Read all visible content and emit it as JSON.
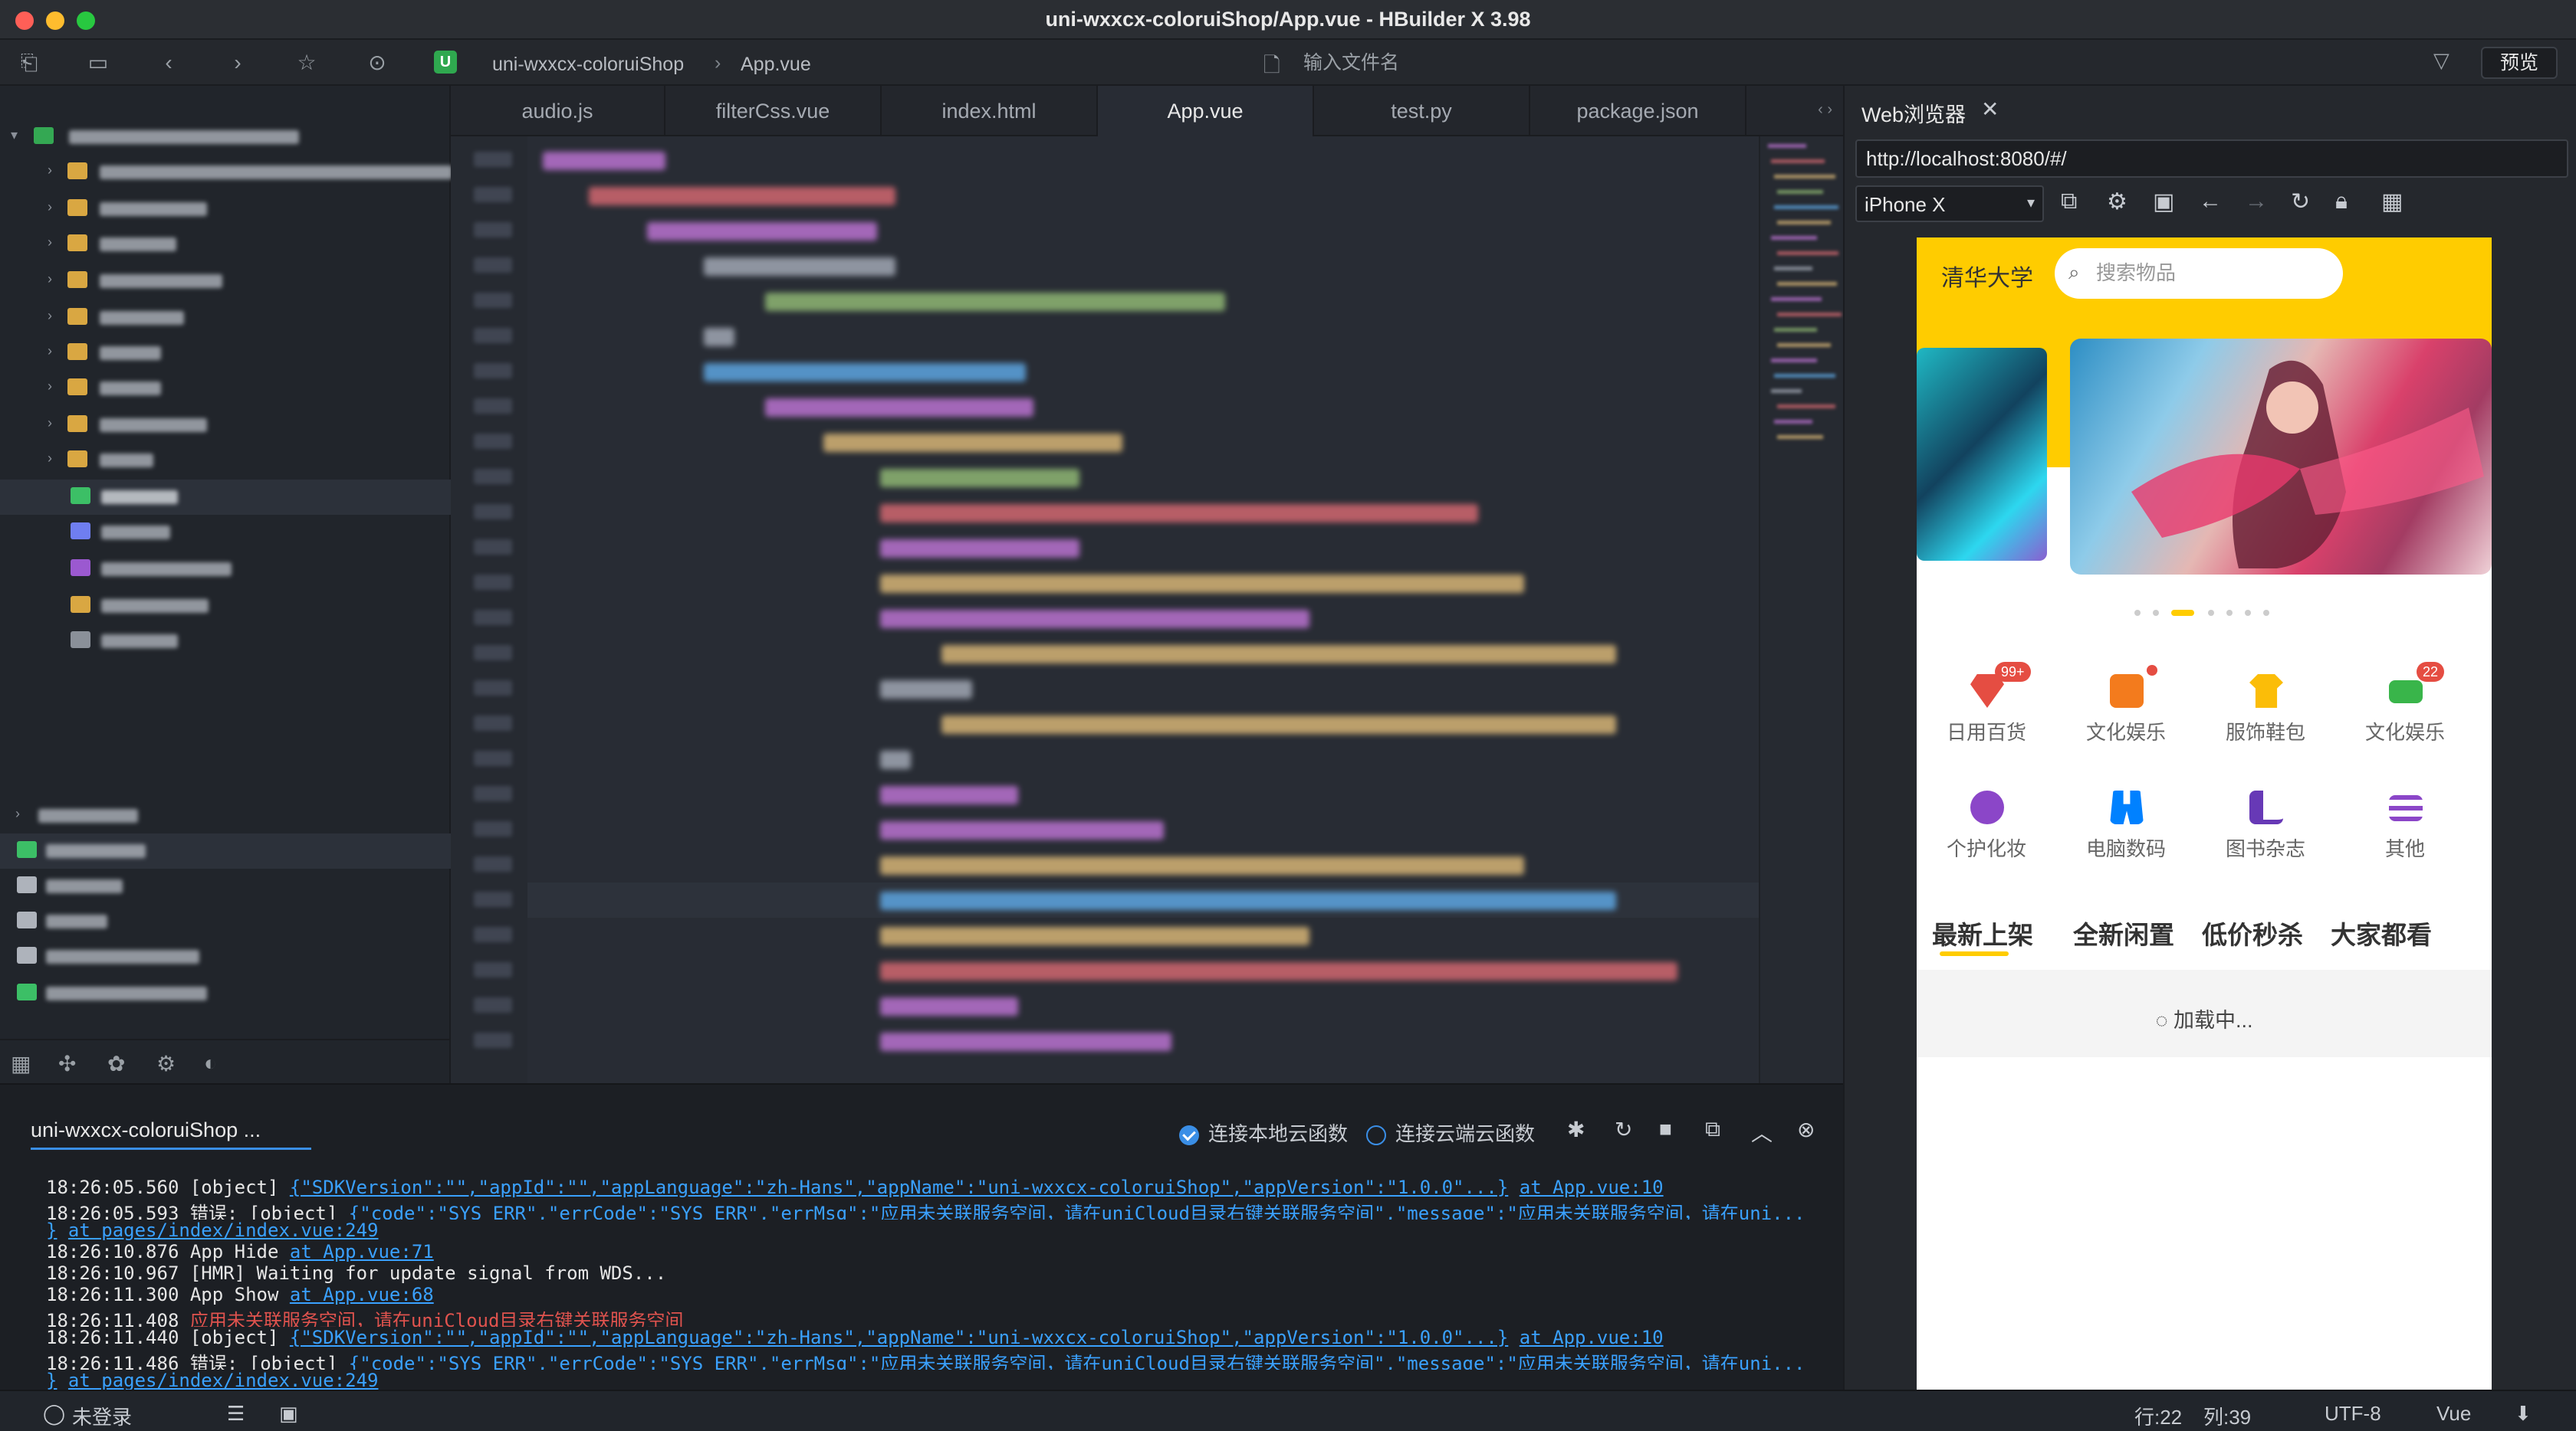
{
  "window": {
    "title": "uni-wxxcx-coloruiShop/App.vue - HBuilder X 3.98"
  },
  "toolbar": {
    "project_name": "uni-wxxcx-coloruiShop",
    "file_name": "App.vue",
    "search_placeholder": "输入文件名",
    "preview_label": "预览"
  },
  "editor_tabs": [
    {
      "label": "audio.js"
    },
    {
      "label": "filterCss.vue"
    },
    {
      "label": "index.html"
    },
    {
      "label": "App.vue"
    },
    {
      "label": "test.py"
    },
    {
      "label": "package.json"
    }
  ],
  "console": {
    "tab_label": "uni-wxxcx-coloruiShop ...",
    "local_cloud_label": "连接本地云函数",
    "remote_cloud_label": "连接云端云函数",
    "logs": [
      {
        "time": "18:26:05.560",
        "text": "[object]",
        "link": "{\"SDKVersion\":\"\",\"appId\":\"\",\"appLanguage\":\"zh-Hans\",\"appName\":\"uni-wxxcx-coloruiShop\",\"appVersion\":\"1.0.0\"...}",
        "at": "at App.vue:10"
      },
      {
        "time": "18:26:05.593",
        "text": "错误: [object]",
        "link": "{\"code\":\"SYS_ERR\",\"errCode\":\"SYS_ERR\",\"errMsg\":\"应用未关联服务空间，请在uniCloud目录右键关联服务空间\",\"message\":\"应用未关联服务空间，请在uni...",
        "at": ""
      },
      {
        "time": "",
        "text": "}",
        "link": "",
        "at": "at pages/index/index.vue:249"
      },
      {
        "time": "18:26:10.876",
        "text": "App Hide",
        "link": "",
        "at": "at App.vue:71"
      },
      {
        "time": "18:26:10.967",
        "text": "[HMR] Waiting for update signal from WDS...",
        "link": "",
        "at": ""
      },
      {
        "time": "18:26:11.300",
        "text": "App Show",
        "link": "",
        "at": "at App.vue:68"
      },
      {
        "time": "18:26:11.408",
        "text": "",
        "error": "应用未关联服务空间，请在uniCloud目录右键关联服务空间",
        "link": "",
        "at": ""
      },
      {
        "time": "18:26:11.440",
        "text": "[object]",
        "link": "{\"SDKVersion\":\"\",\"appId\":\"\",\"appLanguage\":\"zh-Hans\",\"appName\":\"uni-wxxcx-coloruiShop\",\"appVersion\":\"1.0.0\"...}",
        "at": "at App.vue:10"
      },
      {
        "time": "18:26:11.486",
        "text": "错误: [object]",
        "link": "{\"code\":\"SYS_ERR\",\"errCode\":\"SYS_ERR\",\"errMsg\":\"应用未关联服务空间，请在uniCloud目录右键关联服务空间\",\"message\":\"应用未关联服务空间，请在uni...",
        "at": ""
      },
      {
        "time": "",
        "text": "}",
        "link": "",
        "at": "at pages/index/index.vue:249"
      }
    ]
  },
  "statusbar": {
    "login": "未登录",
    "line": "行:22",
    "col": "列:39",
    "encoding": "UTF-8",
    "language": "Vue"
  },
  "browser": {
    "title": "Web浏览器",
    "url": "http://localhost:8080/#/",
    "device": "iPhone X"
  },
  "phone": {
    "school": "清华大学",
    "search_placeholder": "搜索物品",
    "categories": [
      {
        "label": "日用百货",
        "badge": "99+",
        "color": "#e54d42"
      },
      {
        "label": "文化娱乐",
        "badge": "",
        "color": "#f37b1d"
      },
      {
        "label": "服饰鞋包",
        "badge": "",
        "color": "#fbbd08"
      },
      {
        "label": "文化娱乐",
        "badge": "22",
        "color": "#39b54a"
      },
      {
        "label": "个护化妆",
        "badge": "",
        "color": "#8b46c8"
      },
      {
        "label": "电脑数码",
        "badge": "",
        "color": "#0081ff"
      },
      {
        "label": "图书杂志",
        "badge": "",
        "color": "#6739b6"
      },
      {
        "label": "其他",
        "badge": "",
        "color": "#8b46c8"
      }
    ],
    "tabs": [
      "最新上架",
      "全新闲置",
      "低价秒杀",
      "大家都看"
    ],
    "loading": "加载中..."
  }
}
